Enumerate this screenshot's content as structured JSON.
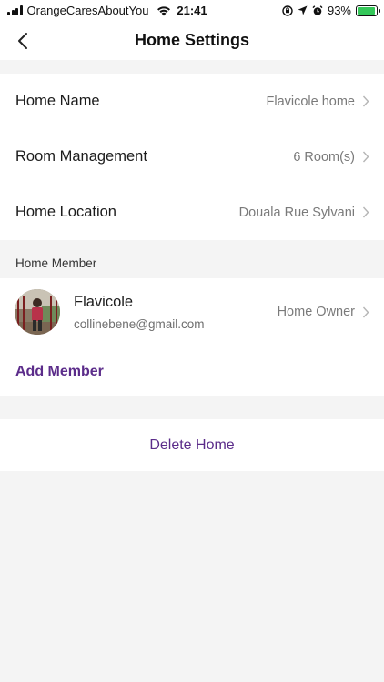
{
  "status_bar": {
    "carrier": "OrangeCaresAboutYou",
    "time": "21:41",
    "battery_percent": "93%",
    "battery_level": 0.93,
    "icons": [
      "signal-icon",
      "wifi-icon",
      "lock-rotation-icon",
      "location-icon",
      "alarm-icon",
      "battery-charging-icon"
    ]
  },
  "nav": {
    "title": "Home Settings",
    "back_icon": "chevron-left-icon"
  },
  "home_info": {
    "rows": [
      {
        "label": "Home Name",
        "value": "Flavicole home"
      },
      {
        "label": "Room Management",
        "value": "6 Room(s)"
      },
      {
        "label": "Home Location",
        "value": "Douala Rue Sylvani"
      }
    ]
  },
  "members": {
    "header": "Home Member",
    "items": [
      {
        "name": "Flavicole",
        "email": "collinebene@gmail.com",
        "role": "Home Owner"
      }
    ],
    "add_label": "Add Member"
  },
  "actions": {
    "delete_label": "Delete Home"
  },
  "colors": {
    "accent": "#5b2c8a",
    "background": "#f4f4f4",
    "secondary_text": "#7a7a7a"
  }
}
